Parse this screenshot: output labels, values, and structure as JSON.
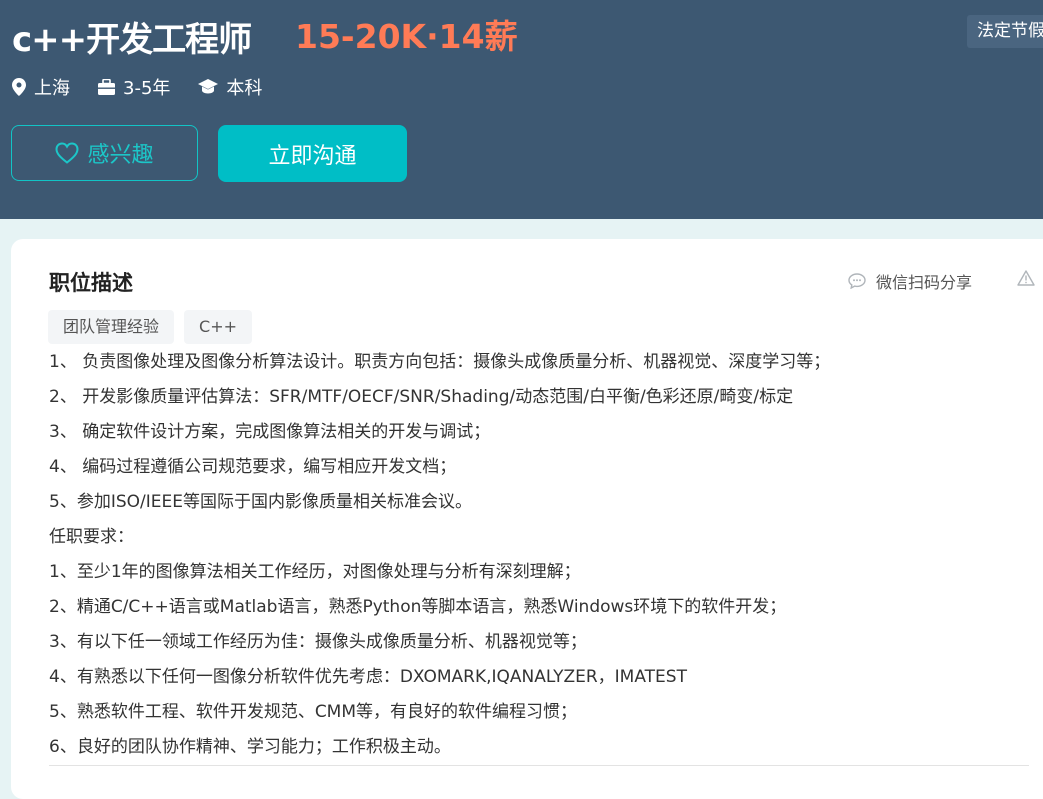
{
  "header": {
    "job_title": "c++开发工程师",
    "salary": "15-20K·14薪",
    "benefit_tag": "法定节假",
    "location": "上海",
    "experience": "3-5年",
    "education": "本科",
    "interest_label": "感兴趣",
    "chat_label": "立即沟通",
    "colors": {
      "accent": "#00bec6",
      "salary": "#ff7b56",
      "banner": "#3d5872"
    },
    "icons": [
      "location-pin-icon",
      "briefcase-icon",
      "graduation-cap-icon",
      "heart-icon"
    ]
  },
  "job": {
    "section_title": "职位描述",
    "share_label": "微信扫码分享",
    "share_icon": "chat-bubble-icon",
    "report_icon": "warning-triangle-icon",
    "tags": [
      "团队管理经验",
      "C++"
    ],
    "lines": [
      "1、 负责图像处理及图像分析算法设计。职责方向包括：摄像头成像质量分析、机器视觉、深度学习等；",
      "2、 开发影像质量评估算法：SFR/MTF/OECF/SNR/Shading/动态范围/白平衡/色彩还原/畸变/标定",
      "3、 确定软件设计方案，完成图像算法相关的开发与调试；",
      "4、 编码过程遵循公司规范要求，编写相应开发文档；",
      "5、参加ISO/IEEE等国际于国内影像质量相关标准会议。",
      "任职要求：",
      "1、至少1年的图像算法相关工作经历，对图像处理与分析有深刻理解；",
      "2、精通C/C++语言或Matlab语言，熟悉Python等脚本语言，熟悉Windows环境下的软件开发；",
      "3、有以下任一领域工作经历为佳：摄像头成像质量分析、机器视觉等；",
      "4、有熟悉以下任何一图像分析软件优先考虑：DXOMARK,IQANALYZER，IMATEST",
      "5、熟悉软件工程、软件开发规范、CMM等，有良好的软件编程习惯；",
      "6、良好的团队协作精神、学习能力；工作积极主动。"
    ]
  }
}
